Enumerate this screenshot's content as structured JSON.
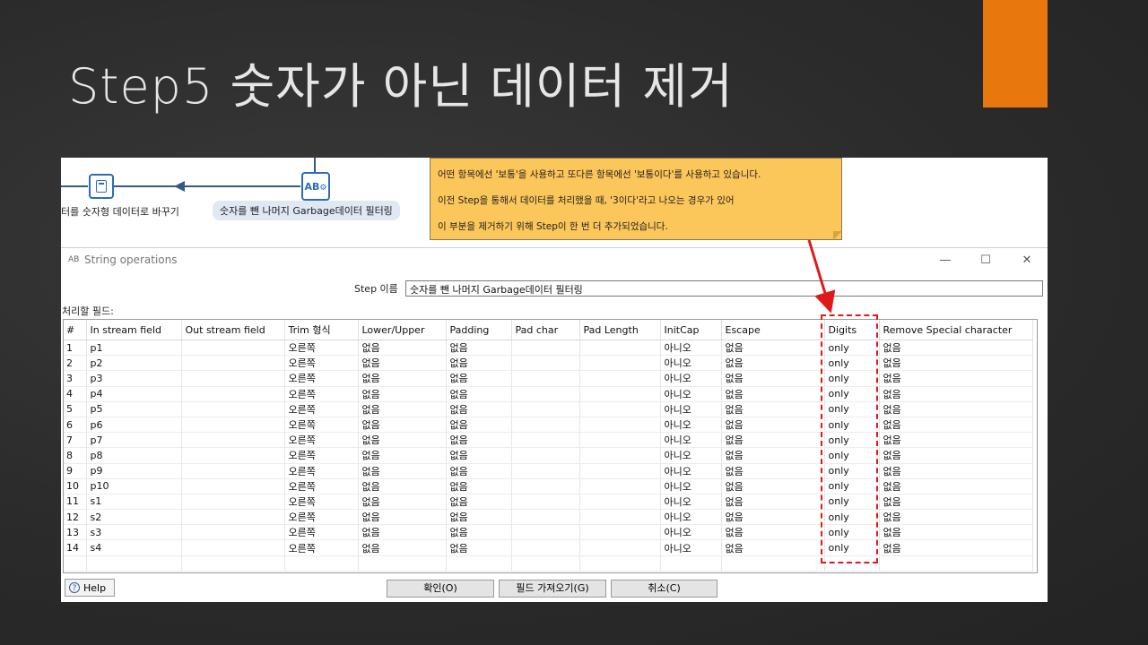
{
  "slide": {
    "title": "Step5 숫자가 아닌 데이터 제거",
    "accent_color": "#e8780e"
  },
  "canvas": {
    "left_step_label": "터를 숫자형 데이터로 바꾸기",
    "selected_step_label": "숫자를 뺀 나머지 Garbage데이터 필터링",
    "note_lines": [
      "어떤 항목에선 '보통'을 사용하고 또다른 항목에선 '보통이다'를 사용하고 있습니다.",
      "이전 Step을 통해서 데이터를 처리했을 때, '3이다'라고 나오는 경우가 있어",
      "이 부분을 제거하기 위해 Step이 한 번 더 추가되었습니다."
    ]
  },
  "dialog": {
    "title": "String operations",
    "icon_text": "AB",
    "controls": {
      "minimize": "—",
      "maximize": "☐",
      "close": "✕"
    },
    "step_name_label": "Step 이름",
    "step_name_value": "숫자를 뺀 나머지 Garbage데이터 필터링",
    "fields_label": "처리할 필드:",
    "columns": [
      "#",
      "In stream field",
      "Out stream field",
      "Trim 형식",
      "Lower/Upper",
      "Padding",
      "Pad char",
      "Pad Length",
      "InitCap",
      "Escape",
      "Digits",
      "Remove Special character"
    ],
    "rows": [
      [
        "1",
        "p1",
        "",
        "오른쪽",
        "없음",
        "없음",
        "",
        "",
        "아니오",
        "없음",
        "only",
        "없음"
      ],
      [
        "2",
        "p2",
        "",
        "오른쪽",
        "없음",
        "없음",
        "",
        "",
        "아니오",
        "없음",
        "only",
        "없음"
      ],
      [
        "3",
        "p3",
        "",
        "오른쪽",
        "없음",
        "없음",
        "",
        "",
        "아니오",
        "없음",
        "only",
        "없음"
      ],
      [
        "4",
        "p4",
        "",
        "오른쪽",
        "없음",
        "없음",
        "",
        "",
        "아니오",
        "없음",
        "only",
        "없음"
      ],
      [
        "5",
        "p5",
        "",
        "오른쪽",
        "없음",
        "없음",
        "",
        "",
        "아니오",
        "없음",
        "only",
        "없음"
      ],
      [
        "6",
        "p6",
        "",
        "오른쪽",
        "없음",
        "없음",
        "",
        "",
        "아니오",
        "없음",
        "only",
        "없음"
      ],
      [
        "7",
        "p7",
        "",
        "오른쪽",
        "없음",
        "없음",
        "",
        "",
        "아니오",
        "없음",
        "only",
        "없음"
      ],
      [
        "8",
        "p8",
        "",
        "오른쪽",
        "없음",
        "없음",
        "",
        "",
        "아니오",
        "없음",
        "only",
        "없음"
      ],
      [
        "9",
        "p9",
        "",
        "오른쪽",
        "없음",
        "없음",
        "",
        "",
        "아니오",
        "없음",
        "only",
        "없음"
      ],
      [
        "10",
        "p10",
        "",
        "오른쪽",
        "없음",
        "없음",
        "",
        "",
        "아니오",
        "없음",
        "only",
        "없음"
      ],
      [
        "11",
        "s1",
        "",
        "오른쪽",
        "없음",
        "없음",
        "",
        "",
        "아니오",
        "없음",
        "only",
        "없음"
      ],
      [
        "12",
        "s2",
        "",
        "오른쪽",
        "없음",
        "없음",
        "",
        "",
        "아니오",
        "없음",
        "only",
        "없음"
      ],
      [
        "13",
        "s3",
        "",
        "오른쪽",
        "없음",
        "없음",
        "",
        "",
        "아니오",
        "없음",
        "only",
        "없음"
      ],
      [
        "14",
        "s4",
        "",
        "오른쪽",
        "없음",
        "없음",
        "",
        "",
        "아니오",
        "없음",
        "only",
        "없음"
      ]
    ],
    "buttons": {
      "help": "Help",
      "ok": "확인(O)",
      "get_fields": "필드 가져오기(G)",
      "cancel": "취소(C)"
    },
    "highlight_color": "#e01818"
  }
}
